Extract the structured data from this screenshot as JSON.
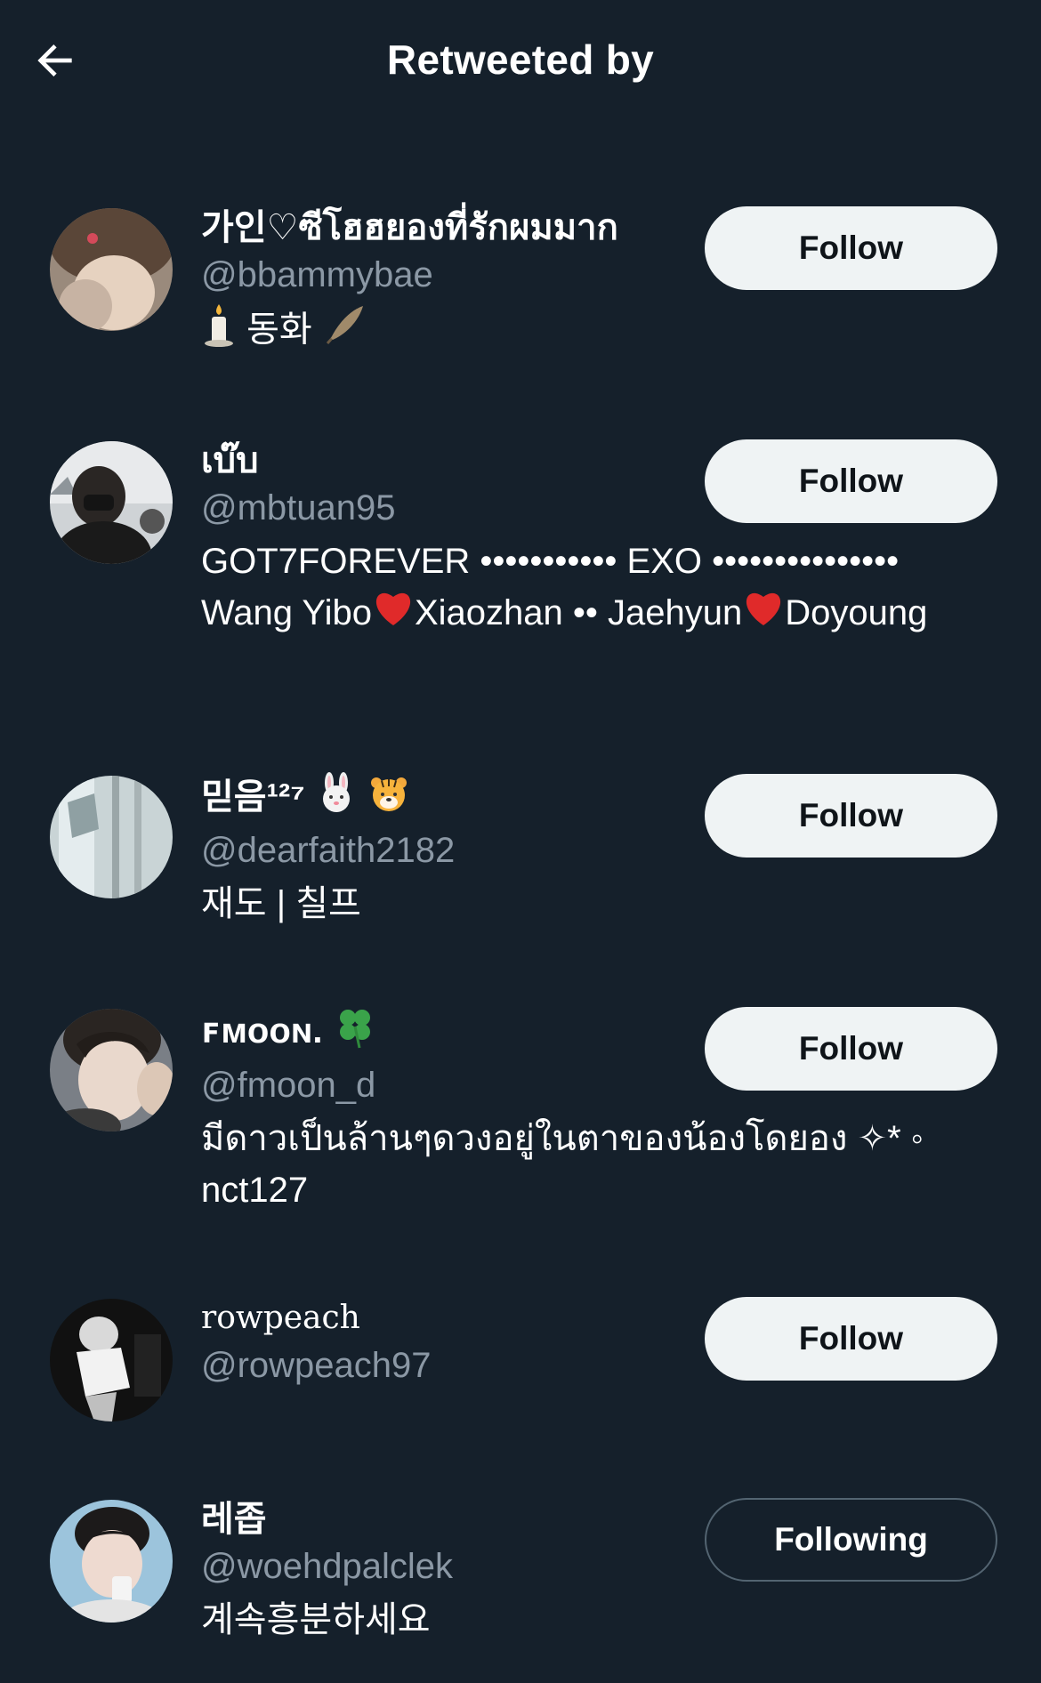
{
  "header": {
    "title": "Retweeted by"
  },
  "users": [
    {
      "display_name": "가인♡ซีโฮฮยองที่รักผมมาก",
      "handle": "@bbammybae",
      "bio": "동화",
      "button": "Follow"
    },
    {
      "display_name": "เบ๊บ",
      "handle": "@mbtuan95",
      "bio_parts": [
        "GOT7FOREVER ••••••••••• EXO ••••••••••••••• Wang Yibo",
        "Xiaozhan •• Jaehyun",
        "Doyoung"
      ],
      "button": "Follow"
    },
    {
      "display_name": "믿음¹²⁷",
      "handle": "@dearfaith2182",
      "bio": "재도 | 칠프",
      "button": "Follow"
    },
    {
      "display_name": "ꜰᴍᴏᴏɴ.",
      "handle": "@fmoon_d",
      "bio": "มีดาวเป็นล้านๆดวงอยู่ในตาของน้องโดยอง ✧* ◦ nct127",
      "button": "Follow"
    },
    {
      "display_name": "rowpeach",
      "handle": "@rowpeach97",
      "bio": "",
      "button": "Follow"
    },
    {
      "display_name": "레좁",
      "handle": "@woehdpalclek",
      "bio": "계속흥분하세요",
      "button": "Following"
    }
  ],
  "icons": {
    "back": "arrow-left-icon",
    "heart_color": "#e0245e"
  }
}
